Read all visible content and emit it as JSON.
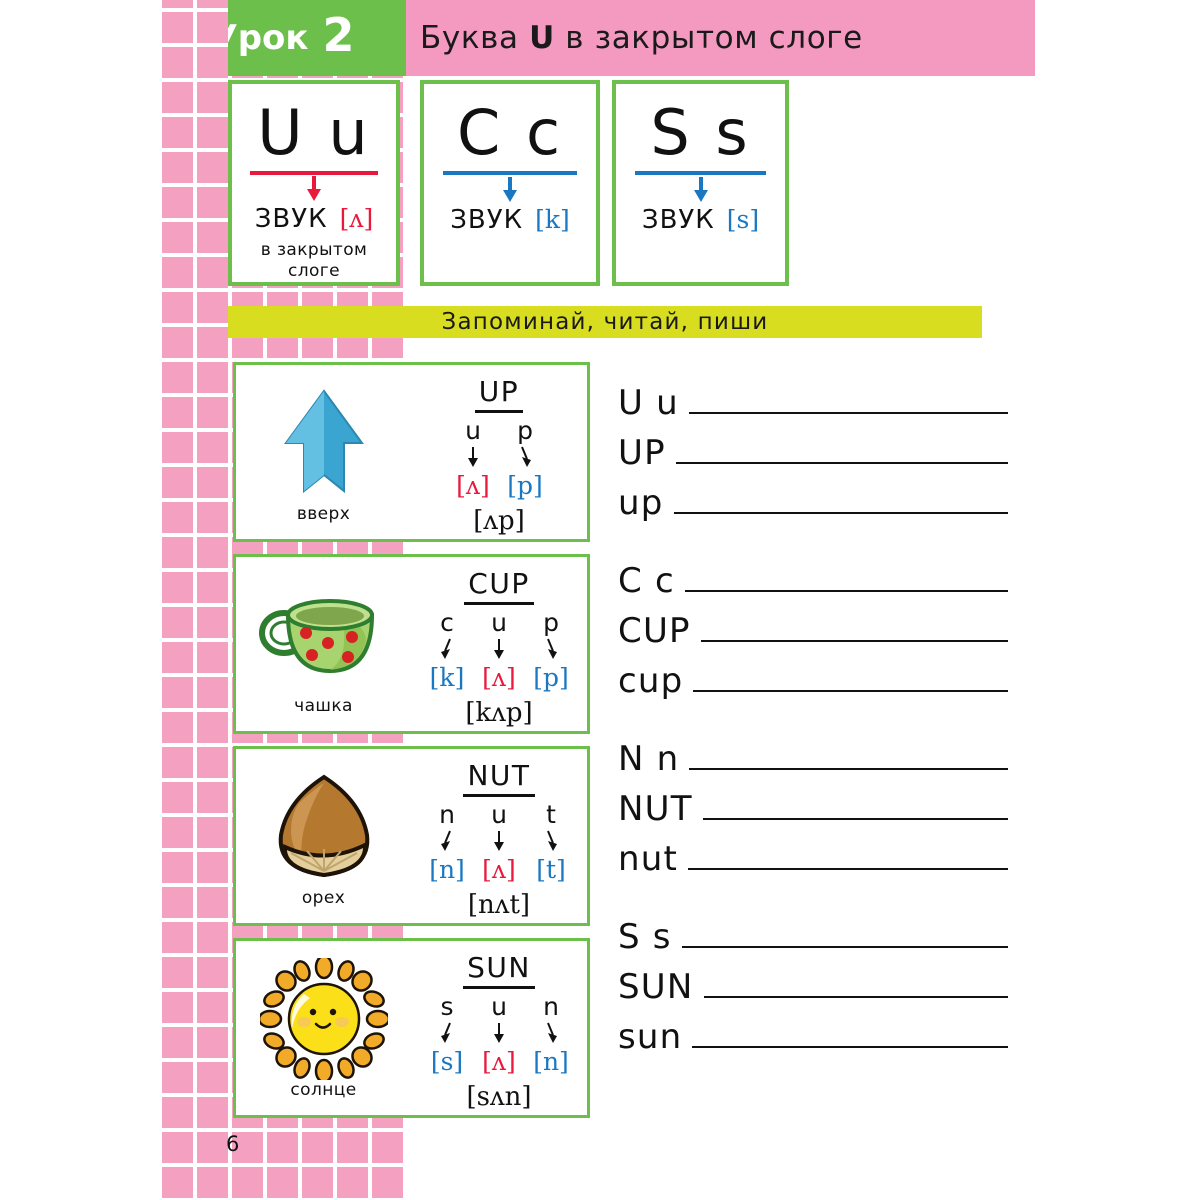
{
  "header": {
    "lesson_word": "Урок",
    "lesson_number": "2",
    "title_prefix": "Буква ",
    "title_letter": "U",
    "title_suffix": " в закрытом слоге",
    "green_color": "#6cbf4b",
    "pink_color": "#f49ac1"
  },
  "banner": {
    "text": "Запоминай, читай, пиши",
    "color": "#d8dd1f"
  },
  "letter_cards": [
    {
      "glyphs": "U u",
      "rule_color": "#e8193c",
      "arrow_color": "#e8193c",
      "sound_label": "ЗВУК",
      "sound_value": "[ʌ]",
      "sound_color": "#e8193c",
      "note_line1": "в закрытом",
      "note_line2": "слоге"
    },
    {
      "glyphs": "C c",
      "rule_color": "#1a78c2",
      "arrow_color": "#1a78c2",
      "sound_label": "ЗВУК",
      "sound_value": "[k]",
      "sound_color": "#1a78c2",
      "note_line1": "",
      "note_line2": ""
    },
    {
      "glyphs": "S s",
      "rule_color": "#1a78c2",
      "arrow_color": "#1a78c2",
      "sound_label": "ЗВУК",
      "sound_value": "[s]",
      "sound_color": "#1a78c2",
      "note_line1": "",
      "note_line2": ""
    }
  ],
  "word_cards": [
    {
      "icon": "up-arrow-icon",
      "caption": "вверх",
      "word_upper": "UP",
      "letters": [
        "u",
        "p"
      ],
      "sounds": [
        "[ʌ]",
        "[p]"
      ],
      "sound_colors": [
        "#e8193c",
        "#1a78c2"
      ],
      "transcript": "[ʌp]"
    },
    {
      "icon": "cup-icon",
      "caption": "чашка",
      "word_upper": "CUP",
      "letters": [
        "c",
        "u",
        "p"
      ],
      "sounds": [
        "[k]",
        "[ʌ]",
        "[p]"
      ],
      "sound_colors": [
        "#1a78c2",
        "#e8193c",
        "#1a78c2"
      ],
      "transcript": "[kʌp]"
    },
    {
      "icon": "nut-icon",
      "caption": "орех",
      "word_upper": "NUT",
      "letters": [
        "n",
        "u",
        "t"
      ],
      "sounds": [
        "[n]",
        "[ʌ]",
        "[t]"
      ],
      "sound_colors": [
        "#1a78c2",
        "#e8193c",
        "#1a78c2"
      ],
      "transcript": "[nʌt]"
    },
    {
      "icon": "sun-icon",
      "caption": "солнце",
      "word_upper": "SUN",
      "letters": [
        "s",
        "u",
        "n"
      ],
      "sounds": [
        "[s]",
        "[ʌ]",
        "[n]"
      ],
      "sound_colors": [
        "#1a78c2",
        "#e8193c",
        "#1a78c2"
      ],
      "transcript": "[sʌn]"
    }
  ],
  "practice": {
    "groups": [
      {
        "rows": [
          "U u",
          "UP",
          "up"
        ]
      },
      {
        "rows": [
          "C c",
          "CUP",
          "cup"
        ]
      },
      {
        "rows": [
          "N n",
          "NUT",
          "nut"
        ]
      },
      {
        "rows": [
          "S s",
          "SUN",
          "sun"
        ]
      }
    ]
  },
  "page_number": "6"
}
